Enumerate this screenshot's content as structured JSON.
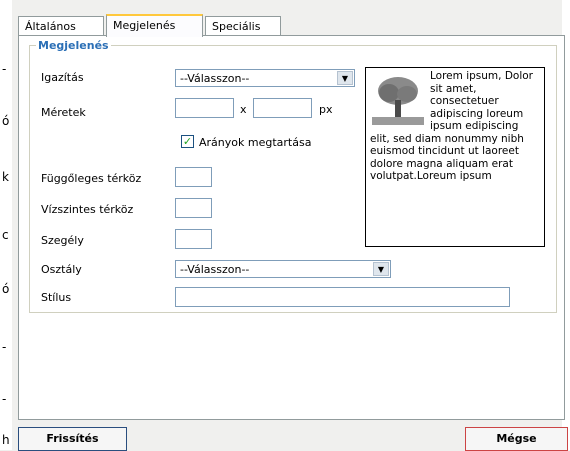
{
  "tabs": [
    {
      "label": "Általános"
    },
    {
      "label": "Megjelenés"
    },
    {
      "label": "Speciális"
    }
  ],
  "group": {
    "legend": "Megjelenés"
  },
  "form": {
    "alignment_label": "Igazítás",
    "alignment_value": "--Válasszon--",
    "dimensions_label": "Méretek",
    "dimensions_sep": "x",
    "dimensions_unit": "px",
    "keep_ratio_label": "Arányok megtartása",
    "keep_ratio_checked": true,
    "vspace_label": "Függőleges térköz",
    "hspace_label": "Vízszintes térköz",
    "border_label": "Szegély",
    "class_label": "Osztály",
    "class_value": "--Válasszon--",
    "style_label": "Stílus"
  },
  "preview": {
    "text": "Lorem ipsum, Dolor sit amet, consectetuer adipiscing loreum ipsum edipiscing elit, sed diam nonummy nibh euismod tincidunt ut laoreet dolore magna aliquam erat volutpat.Loreum ipsum"
  },
  "buttons": {
    "insert_label": "Frissítés",
    "cancel_label": "Mégse"
  },
  "left_strip_chars": [
    "-",
    "-",
    "ó",
    "k",
    "c",
    "ó",
    "-",
    "-",
    "h"
  ],
  "colors": {
    "legend": "#2b6fb6",
    "active_tab_accent": "#ffc83c",
    "checkbox_mark": "#21a121"
  }
}
